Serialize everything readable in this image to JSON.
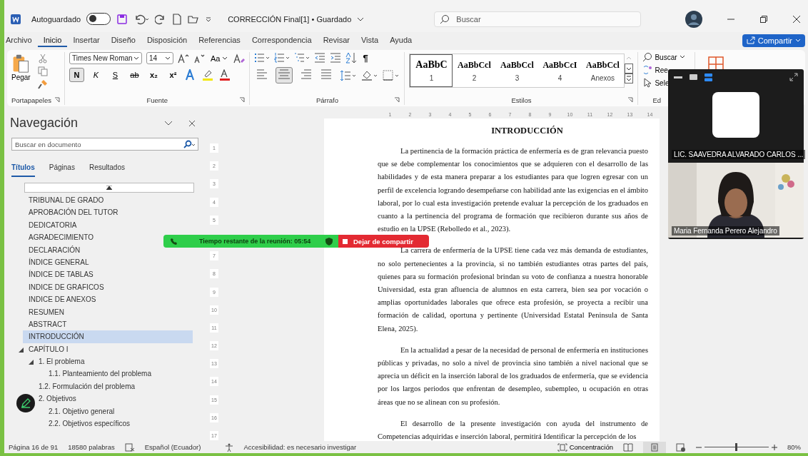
{
  "window": {
    "autosave_label": "Autoguardado",
    "autosave_on": false,
    "title": "CORRECCIÓN Final[1] • Guardado",
    "search_placeholder": "Buscar"
  },
  "menu": [
    {
      "label": "Archivo",
      "selected": false
    },
    {
      "label": "Inicio",
      "selected": true
    },
    {
      "label": "Insertar",
      "selected": false
    },
    {
      "label": "Diseño",
      "selected": false
    },
    {
      "label": "Disposición",
      "selected": false
    },
    {
      "label": "Referencias",
      "selected": false
    },
    {
      "label": "Correspondencia",
      "selected": false
    },
    {
      "label": "Revisar",
      "selected": false
    },
    {
      "label": "Vista",
      "selected": false
    },
    {
      "label": "Ayuda",
      "selected": false
    }
  ],
  "share_button": "Compartir",
  "ribbon": {
    "clipboard": {
      "paste": "Pegar",
      "label": "Portapapeles"
    },
    "font": {
      "label": "Fuente",
      "name": "Times New Roman",
      "size": "14",
      "case_button": "Aa",
      "styles": [
        {
          "label": "N",
          "kind": "bold",
          "selected": true
        },
        {
          "label": "K",
          "kind": "italic",
          "selected": false
        },
        {
          "label": "S",
          "kind": "underline",
          "selected": false
        },
        {
          "label": "ab",
          "kind": "strike",
          "selected": false
        },
        {
          "label": "x₂",
          "kind": "sub",
          "selected": false
        },
        {
          "label": "x²",
          "kind": "sup",
          "selected": false
        }
      ]
    },
    "paragraph": {
      "label": "Párrafo",
      "pilcrow": "¶",
      "alignments": [
        {
          "kind": "left",
          "selected": false
        },
        {
          "kind": "center",
          "selected": true
        },
        {
          "kind": "right",
          "selected": false
        },
        {
          "kind": "justify",
          "selected": false
        }
      ]
    },
    "styles": {
      "label": "Estilos",
      "items": [
        {
          "preview": "AaBbC",
          "name": "1",
          "selected": true
        },
        {
          "preview": "AaBbCcl",
          "name": "2",
          "selected": false
        },
        {
          "preview": "AaBbCcl",
          "name": "3",
          "selected": false
        },
        {
          "preview": "AaBbCcI",
          "name": "4",
          "selected": false
        },
        {
          "preview": "AaBbCcl",
          "name": "Anexos",
          "selected": false
        }
      ]
    },
    "editing": {
      "label": "Ed",
      "items": [
        "Buscar",
        "Ree",
        "Sele"
      ]
    }
  },
  "navigation": {
    "title": "Navegación",
    "search_placeholder": "Buscar en documento",
    "tabs": [
      {
        "label": "Títulos",
        "selected": true
      },
      {
        "label": "Páginas",
        "selected": false
      },
      {
        "label": "Resultados",
        "selected": false
      }
    ],
    "headings": [
      {
        "label": "TRIBUNAL DE GRADO",
        "selected": false
      },
      {
        "label": "APROBACIÓN DEL TUTOR",
        "selected": false
      },
      {
        "label": "DEDICATORIA",
        "selected": false
      },
      {
        "label": "AGRADECIMIENTO",
        "selected": false
      },
      {
        "label": "DECLARACIÓN",
        "selected": false
      },
      {
        "label": "ÍNDICE GENERAL",
        "selected": false
      },
      {
        "label": "ÍNDICE DE TABLAS",
        "selected": false
      },
      {
        "label": "INDICE DE GRAFICOS",
        "selected": false
      },
      {
        "label": "INDICE DE ANEXOS",
        "selected": false
      },
      {
        "label": "RESUMEN",
        "selected": false
      },
      {
        "label": "ABSTRACT",
        "selected": false
      },
      {
        "label": "INTRODUCCIÓN",
        "selected": true
      },
      {
        "label": "CAPÍTULO I",
        "selected": false,
        "expanded": true,
        "children": [
          {
            "label": "1.  El problema",
            "selected": false,
            "expanded": true,
            "children": [
              {
                "label": "1.1. Planteamiento del problema",
                "selected": false
              }
            ]
          },
          {
            "label": "1.2. Formulación del problema",
            "selected": false
          },
          {
            "label": "2. Objetivos",
            "selected": false,
            "children": [
              {
                "label": "2.1. Objetivo general",
                "selected": false
              },
              {
                "label": "2.2. Objetivos específicos",
                "selected": false
              }
            ]
          }
        ]
      }
    ]
  },
  "ruler": {
    "horizontal": [
      "1",
      "2",
      "3",
      "4",
      "5",
      "6",
      "7",
      "8",
      "9",
      "10",
      "11",
      "12",
      "13",
      "14"
    ],
    "vertical": [
      "1",
      "2",
      "3",
      "4",
      "5",
      "7",
      "8",
      "9",
      "10",
      "11",
      "12",
      "13",
      "14",
      "15",
      "16",
      "17"
    ]
  },
  "document": {
    "heading": "INTRODUCCIÓN",
    "paragraphs": [
      "La pertinencia de la formación práctica de enfermería es de gran relevancia puesto que se debe complementar los conocimientos que se adquieren con el desarrollo de las habilidades y de esta manera preparar a los estudiantes para que logren egresar con un perfil de excelencia logrando desempeñarse con habilidad ante las exigencias en el ámbito laboral, por lo cual esta investigación pretende evaluar la percepción de los graduados en cuanto a la pertinencia del programa de formación que recibieron durante sus años de estudio en la UPSE (Rebolledo et al., 2023).",
      "La carrera de enfermería de la UPSE tiene cada vez más demanda de estudiantes, no solo pertenecientes a la provincia, si no también estudiantes otras partes del país, quienes para su formación profesional brindan su voto de confianza a nuestra honorable Universidad, esta gran afluencia de alumnos en esta carrera, bien sea por vocación o amplias oportunidades laborales que ofrece esta profesión, se proyecta a recibir una formación de calidad, oportuna y pertinente (Universidad Estatal Peninsula de Santa Elena, 2025).",
      "En la actualidad a pesar de la necesidad de personal de enfermería en instituciones públicas y privadas, no solo a nivel de provincia sino también a nivel nacional que se aprecia un déficit en la inserción laboral de los graduados de enfermería, que se evidencia por los largos periodos que enfrentan de desempleo, subempleo, u ocupación en otras áreas que no se alinean con su profesión.",
      "El desarrollo de la presente investigación con ayuda del instrumento de Competencias adquiridas e inserción laboral, permitirá Identificar la percepción de los"
    ]
  },
  "status_bar": {
    "page": "Página 16 de 91",
    "words": "18580 palabras",
    "language": "Español (Ecuador)",
    "accessibility": "Accesibilidad: es necesario investigar",
    "focus": "Concentración",
    "zoom": {
      "level": 0.5,
      "reading": "80%"
    }
  },
  "meeting": {
    "time_left": "Tiempo restante de la reunión: 05:54",
    "stop_share": "Dejar de compartir",
    "participants": [
      {
        "name": "LIC. SAAVEDRA ALVARADO CARLOS ...",
        "kind": "avatar"
      },
      {
        "name": "Maria Fernanda Perero Alejandro",
        "kind": "video"
      }
    ]
  }
}
